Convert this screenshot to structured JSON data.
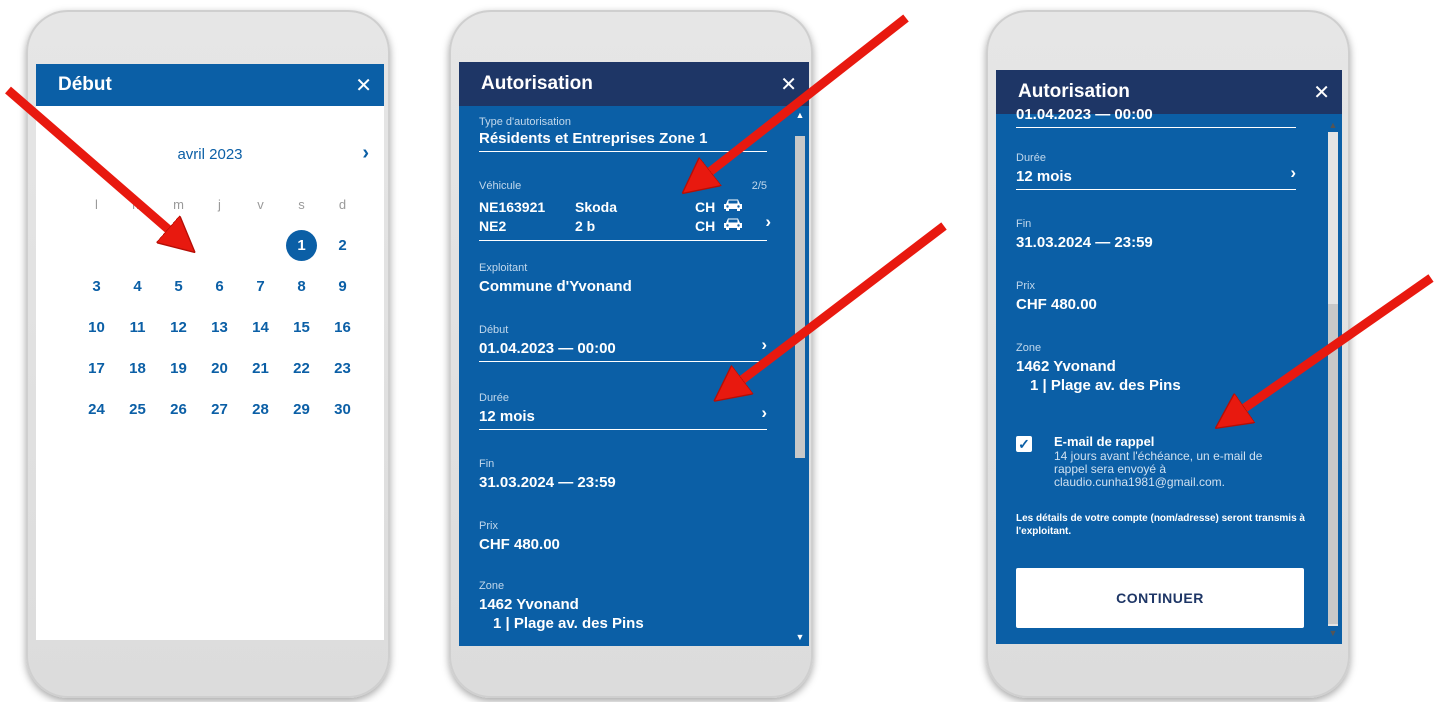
{
  "calendar": {
    "title": "Début",
    "close": "✕",
    "month": "avril 2023",
    "prev": "‹",
    "next": "›",
    "weekdays": [
      "l",
      "m",
      "m",
      "j",
      "v",
      "s",
      "d"
    ],
    "weeks": [
      [
        "",
        "",
        "",
        "",
        "",
        "1",
        "2"
      ],
      [
        "3",
        "4",
        "5",
        "6",
        "7",
        "8",
        "9"
      ],
      [
        "10",
        "11",
        "12",
        "13",
        "14",
        "15",
        "16"
      ],
      [
        "17",
        "18",
        "19",
        "20",
        "21",
        "22",
        "23"
      ],
      [
        "24",
        "25",
        "26",
        "27",
        "28",
        "29",
        "30"
      ]
    ],
    "selected_day": "1"
  },
  "auth1": {
    "title": "Autorisation",
    "close": "✕",
    "type_label": "Type d'autorisation",
    "type_value": "Résidents et Entreprises Zone 1",
    "vehicle_label": "Véhicule",
    "vehicle_count": "2/5",
    "vehicles": [
      {
        "plate": "NE163921",
        "make": "Skoda",
        "country": "CH"
      },
      {
        "plate": "NE2",
        "make": "2 b",
        "country": "CH"
      }
    ],
    "operator_label": "Exploitant",
    "operator_value": "Commune d'Yvonand",
    "start_label": "Début",
    "start_value": "01.04.2023 — 00:00",
    "duration_label": "Durée",
    "duration_value": "12 mois",
    "end_label": "Fin",
    "end_value": "31.03.2024 — 23:59",
    "price_label": "Prix",
    "price_value": "CHF 480.00",
    "zone_label": "Zone",
    "zone_value": "1462 Yvonand",
    "zone_sub": "1 | Plage av. des Pins"
  },
  "auth2": {
    "title": "Autorisation",
    "close": "✕",
    "partial_top": "01.04.2023 — 00:00",
    "duration_label": "Durée",
    "duration_value": "12 mois",
    "end_label": "Fin",
    "end_value": "31.03.2024 — 23:59",
    "price_label": "Prix",
    "price_value": "CHF 480.00",
    "zone_label": "Zone",
    "zone_value": "1462 Yvonand",
    "zone_sub": "1 | Plage av. des Pins",
    "reminder_title": "E-mail de rappel",
    "reminder_text": "14 jours avant l'échéance, un e-mail de rappel sera envoyé à claudio.cunha1981@gmail.com.",
    "reminder_checked": true,
    "notice": "Les détails de votre compte (nom/adresse) seront transmis à l'exploitant.",
    "continue_label": "CONTINUER"
  },
  "colors": {
    "panel_blue": "#0b5fa6",
    "title_navy": "#1e3666",
    "arrow_red": "#e8190f"
  }
}
